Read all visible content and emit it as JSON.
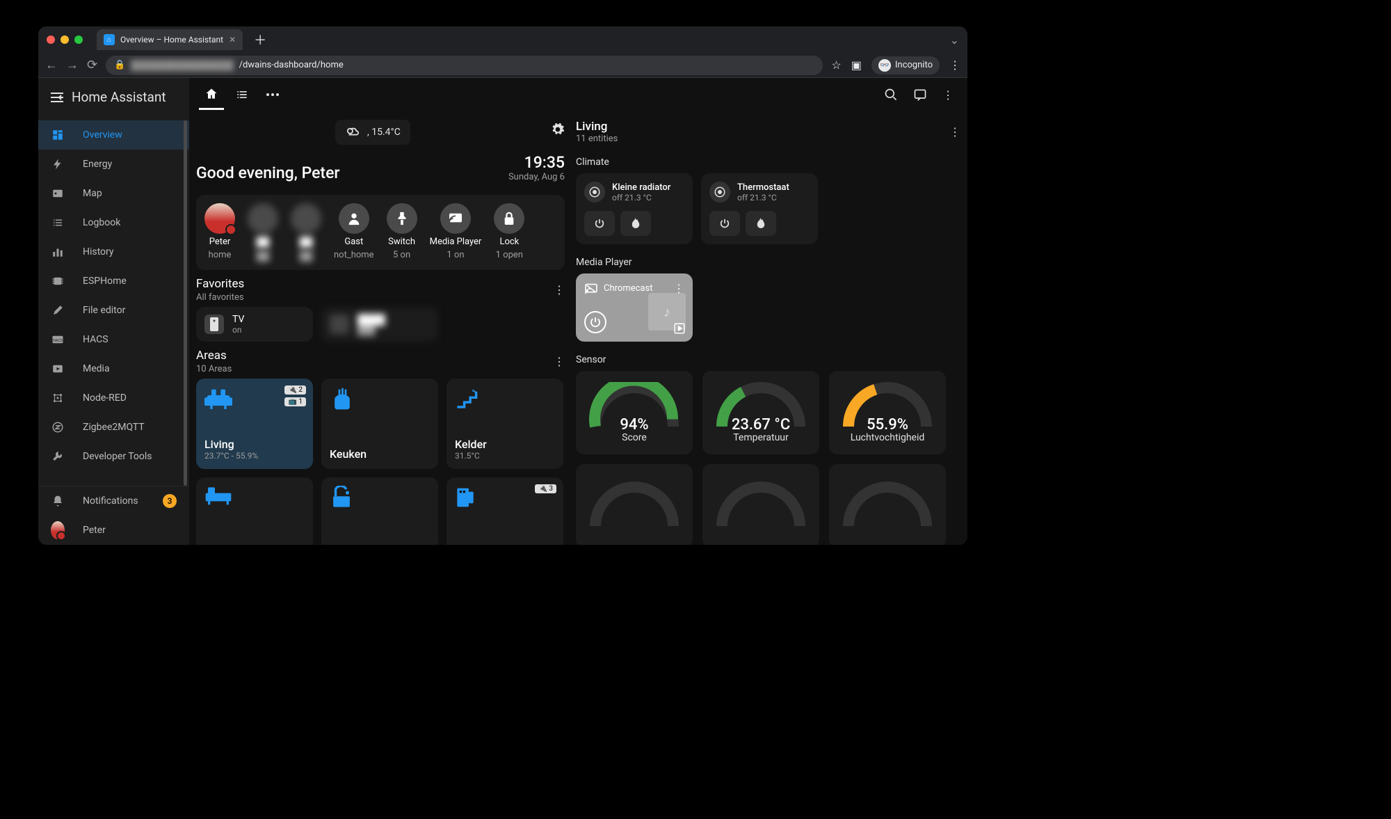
{
  "browser": {
    "tab_title": "Overview – Home Assistant",
    "url_path": "/dwains-dashboard/home",
    "incognito": "Incognito"
  },
  "app": {
    "name": "Home Assistant",
    "nav": [
      {
        "label": "Overview",
        "active": true
      },
      {
        "label": "Energy"
      },
      {
        "label": "Map"
      },
      {
        "label": "Logbook"
      },
      {
        "label": "History"
      },
      {
        "label": "ESPHome"
      },
      {
        "label": "File editor"
      },
      {
        "label": "HACS"
      },
      {
        "label": "Media"
      },
      {
        "label": "Node-RED"
      },
      {
        "label": "Zigbee2MQTT"
      },
      {
        "label": "Developer Tools"
      }
    ],
    "notifications": {
      "label": "Notifications",
      "count": "3"
    },
    "user": "Peter"
  },
  "weather": {
    "text": ", 15.4°C"
  },
  "greeting": "Good evening, Peter",
  "clock": {
    "time": "19:35",
    "date": "Sunday, Aug 6"
  },
  "presence": [
    {
      "name": "Peter",
      "state": "home",
      "type": "avatar"
    },
    {
      "name": "",
      "state": "",
      "type": "blur"
    },
    {
      "name": "",
      "state": "",
      "type": "blur"
    },
    {
      "name": "Gast",
      "state": "not_home",
      "type": "icon"
    },
    {
      "name": "Switch",
      "state": "5 on",
      "type": "icon"
    },
    {
      "name": "Media Player",
      "state": "1 on",
      "type": "icon"
    },
    {
      "name": "Lock",
      "state": "1 open",
      "type": "icon"
    }
  ],
  "favorites": {
    "title": "Favorites",
    "subtitle": "All favorites",
    "items": [
      {
        "name": "TV",
        "state": "on"
      }
    ]
  },
  "areas": {
    "title": "Areas",
    "subtitle": "10 Areas",
    "items": [
      {
        "name": "Living",
        "sub": "23.7°C - 55.9%",
        "active": true,
        "badges": [
          "2",
          "1"
        ]
      },
      {
        "name": "Keuken",
        "sub": ""
      },
      {
        "name": "Kelder",
        "sub": "31.5°C"
      }
    ]
  },
  "panel": {
    "title": "Living",
    "sub": "11 entities",
    "sections": {
      "climate": {
        "label": "Climate",
        "items": [
          {
            "name": "Kleine radiator",
            "state": "off 21.3 °C"
          },
          {
            "name": "Thermostaat",
            "state": "off 21.3 °C"
          }
        ]
      },
      "media": {
        "label": "Media Player",
        "name": "Chromecast"
      },
      "sensor": {
        "label": "Sensor",
        "items": [
          {
            "value": "94%",
            "label": "Score",
            "pct": 0.94,
            "color": "#43a047"
          },
          {
            "value": "23.67 °C",
            "label": "Temperatuur",
            "pct": 0.35,
            "color": "#43a047"
          },
          {
            "value": "55.9%",
            "label": "Luchtvochtigheid",
            "pct": 0.4,
            "color": "#f9a825"
          }
        ]
      }
    }
  }
}
